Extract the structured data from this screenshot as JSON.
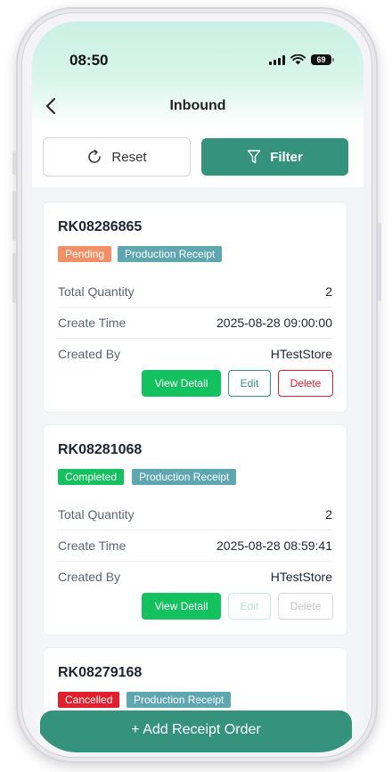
{
  "status_bar": {
    "time": "08:50",
    "battery": "69"
  },
  "header": {
    "title": "Inbound"
  },
  "actions": {
    "reset_label": "Reset",
    "filter_label": "Filter"
  },
  "labels": {
    "total_quantity": "Total Quantity",
    "create_time": "Create Time",
    "created_by": "Created By"
  },
  "buttons": {
    "view_detail": "View Detail",
    "edit": "Edit",
    "delete": "Delete"
  },
  "orders": [
    {
      "code": "RK08286865",
      "status": "Pending",
      "type": "Production Receipt",
      "total_quantity": "2",
      "create_time": "2025-08-28 09:00:00",
      "created_by": "HTestStore"
    },
    {
      "code": "RK08281068",
      "status": "Completed",
      "type": "Production Receipt",
      "total_quantity": "2",
      "create_time": "2025-08-28 08:59:41",
      "created_by": "HTestStore"
    },
    {
      "code": "RK08279168",
      "status": "Cancelled",
      "type": "Production Receipt"
    }
  ],
  "footer": {
    "add_label": "+ Add Receipt Order"
  },
  "colors": {
    "primary": "#35927d",
    "success": "#13c15e",
    "pending": "#f38f64",
    "danger": "#e0202e",
    "type_tag": "#5ea6b0",
    "header_gradient": "#c9f1e3"
  }
}
